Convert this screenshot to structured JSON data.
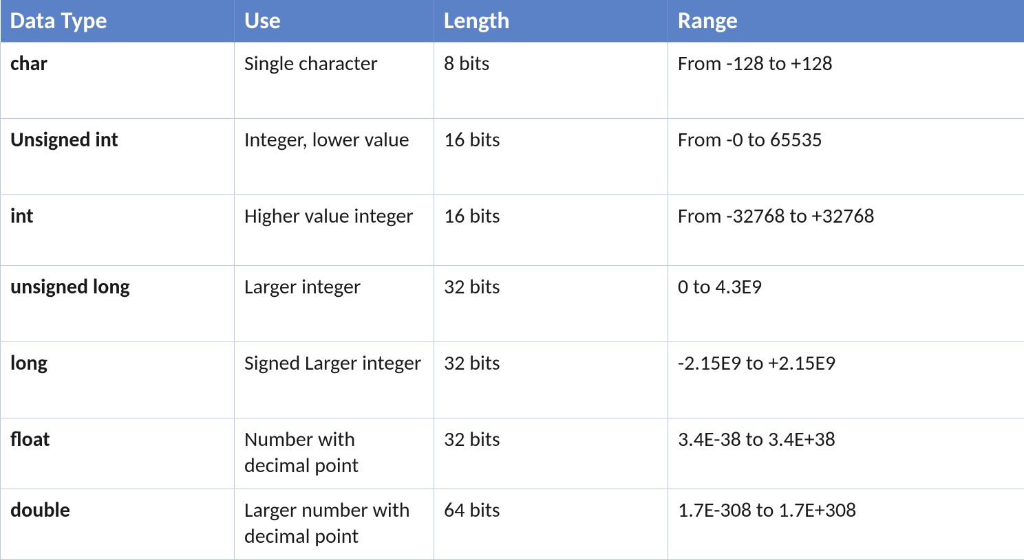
{
  "table": {
    "headers": {
      "data_type": "Data Type",
      "use": "Use",
      "length": "Length",
      "range": "Range"
    },
    "rows": [
      {
        "data_type": "char",
        "use": "Single character",
        "length": "8 bits",
        "range": " From -128 to +128"
      },
      {
        "data_type": "Unsigned  int",
        "use": "Integer, lower value",
        "length": "16 bits",
        "range": "From -0 to 65535"
      },
      {
        "data_type": "int",
        "use": "Higher value integer",
        "length": "16 bits",
        "range": "From -32768 to +32768"
      },
      {
        "data_type": "unsigned long",
        "use": "Larger integer",
        "length": "32 bits",
        "range": "0 to 4.3E9"
      },
      {
        "data_type": "long",
        "use": "Signed Larger integer",
        "length": "32 bits",
        "range": "-2.15E9 to +2.15E9"
      },
      {
        "data_type": "float",
        "use": "Number with decimal point",
        "length": "32 bits",
        "range": "3.4E-38 to 3.4E+38"
      },
      {
        "data_type": "double",
        "use": "Larger number with decimal point",
        "length": "64 bits",
        "range": "1.7E-308 to 1.7E+308"
      }
    ]
  },
  "chart_data": {
    "type": "table",
    "title": "",
    "columns": [
      "Data Type",
      "Use",
      "Length",
      "Range"
    ],
    "rows": [
      [
        "char",
        "Single character",
        "8 bits",
        "From -128 to +128"
      ],
      [
        "Unsigned  int",
        "Integer, lower value",
        "16 bits",
        "From -0 to 65535"
      ],
      [
        "int",
        "Higher value integer",
        "16 bits",
        "From -32768 to +32768"
      ],
      [
        "unsigned long",
        "Larger integer",
        "32 bits",
        "0 to 4.3E9"
      ],
      [
        "long",
        "Signed Larger integer",
        "32 bits",
        "-2.15E9 to +2.15E9"
      ],
      [
        "float",
        "Number with decimal point",
        "32 bits",
        "3.4E-38 to 3.4E+38"
      ],
      [
        "double",
        "Larger number with decimal point",
        "64 bits",
        "1.7E-308 to 1.7E+308"
      ]
    ]
  }
}
